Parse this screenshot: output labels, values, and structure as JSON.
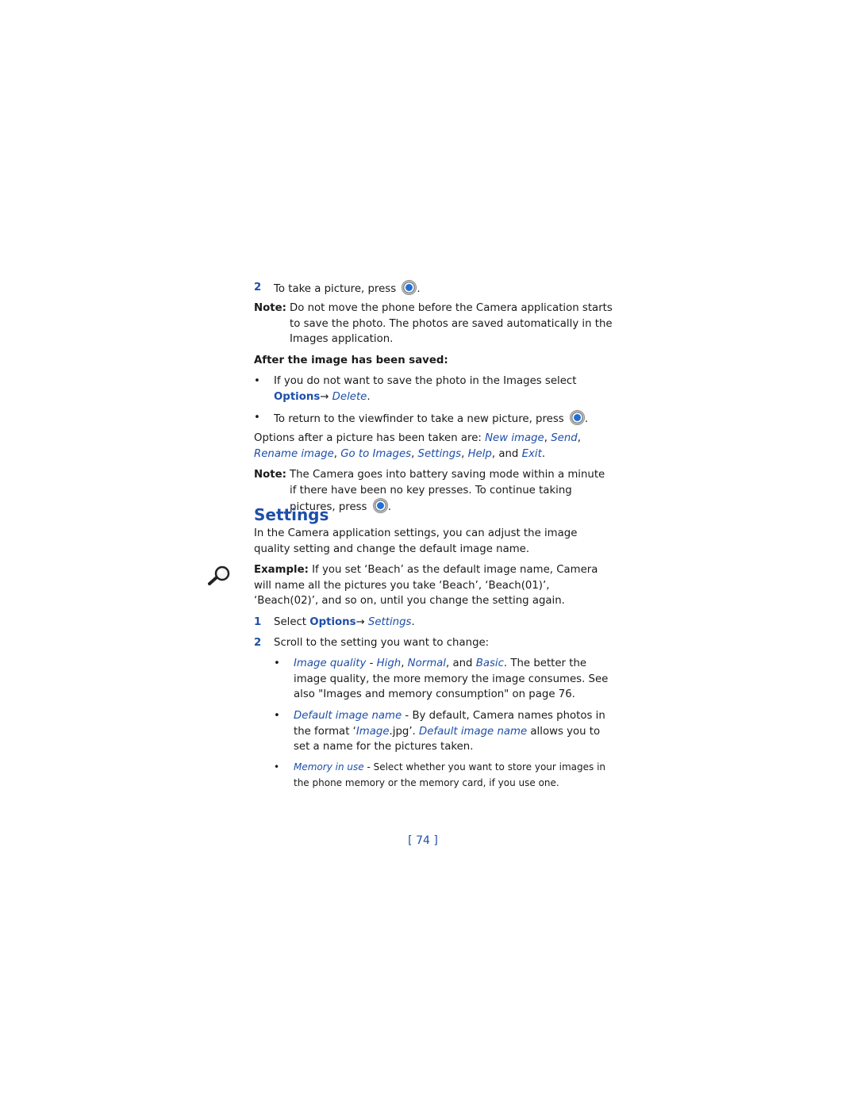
{
  "step2a": {
    "num": "2",
    "text": "To take a picture, press",
    "end": "."
  },
  "note1": {
    "label": "Note:",
    "text": "Do not move the phone before the Camera application starts to save the photo. The photos are saved automatically in the Images application."
  },
  "after_heading": "After the image has been saved:",
  "bullets1": [
    {
      "text": "If you do not want to save the photo in the Images select",
      "menu": "Options",
      "arrow": "→",
      "item": "Delete",
      "end": "."
    },
    {
      "text": "To return to the viewfinder to take a new picture, press",
      "end": "."
    }
  ],
  "options_para": {
    "intro": "Options after a picture has been taken are:",
    "items": [
      "New image",
      "Send",
      "Rename image",
      "Go to Images",
      "Settings",
      "Help",
      "Exit"
    ],
    "sep": ", ",
    "and": "and",
    "end": "."
  },
  "note2": {
    "label": "Note:",
    "text": "The Camera goes into battery saving mode within a minute if there have been no key presses. To continue taking pictures, press",
    "end": "."
  },
  "settings": {
    "title": "Settings",
    "intro": "In the Camera application settings, you can adjust the image quality setting and change the default image name.",
    "example_label": "Example:",
    "example_text": "If you set ‘Beach’ as the default image name, Camera will name all the pictures you take ‘Beach’, ‘Beach(01)’, ‘Beach(02)’, and so on, until you change the setting again.",
    "step1": {
      "num": "1",
      "text": "Select",
      "menu": "Options",
      "arrow": "→",
      "item": "Settings",
      "end": "."
    },
    "step2": {
      "num": "2",
      "text": "Scroll to the setting you want to change:"
    },
    "items": [
      {
        "name": "Image quality",
        "dash": " - ",
        "v1": "High",
        "v2": "Normal",
        "and": ", and ",
        "v3": "Basic",
        "rest": ". The better the image quality, the more memory the image consumes. See also \"Images and memory consumption\" on page 76."
      },
      {
        "name": "Default image name",
        "dash": " - ",
        "rest1": "By default, Camera names photos in the format ‘",
        "fmt": "Image",
        "rest2": ".jpg’. ",
        "name2": "Default image name",
        "rest3": " allows you to set a name for the pictures taken."
      },
      {
        "name": "Memory in use",
        "dash": " - ",
        "rest": "Select whether you want to store your images in the phone memory or the memory card, if you use one."
      }
    ]
  },
  "page_number": "[ 74 ]",
  "colors": {
    "accent": "#1e4fa8",
    "text": "#1a1a1a"
  }
}
